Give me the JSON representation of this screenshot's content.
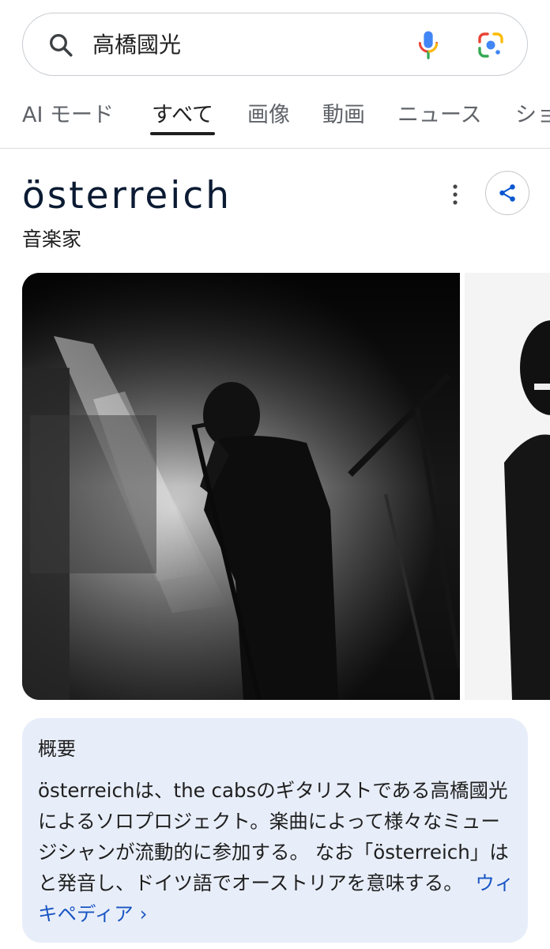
{
  "search": {
    "query": "高橋國光"
  },
  "tabs": [
    {
      "label": "AI モード",
      "active": false
    },
    {
      "label": "すべて",
      "active": true
    },
    {
      "label": "画像",
      "active": false
    },
    {
      "label": "動画",
      "active": false
    },
    {
      "label": "ニュース",
      "active": false
    },
    {
      "label": "ショ",
      "active": false
    }
  ],
  "knowledge_panel": {
    "title": "österreich",
    "subtitle": "音楽家"
  },
  "overview": {
    "heading": "概要",
    "body": "österreichは、the cabsのギタリストである高橋國光によるソロプロジェクト。楽曲によって様々なミュージシャンが流動的に参加する。 なお「österreich」は と発音し、ドイツ語でオーストリアを意味する。",
    "link_label": "ウィキペディア ›"
  },
  "colors": {
    "accent_link": "#1a56c4",
    "card_background": "#e8eef9",
    "title_color": "#0b1b33"
  }
}
